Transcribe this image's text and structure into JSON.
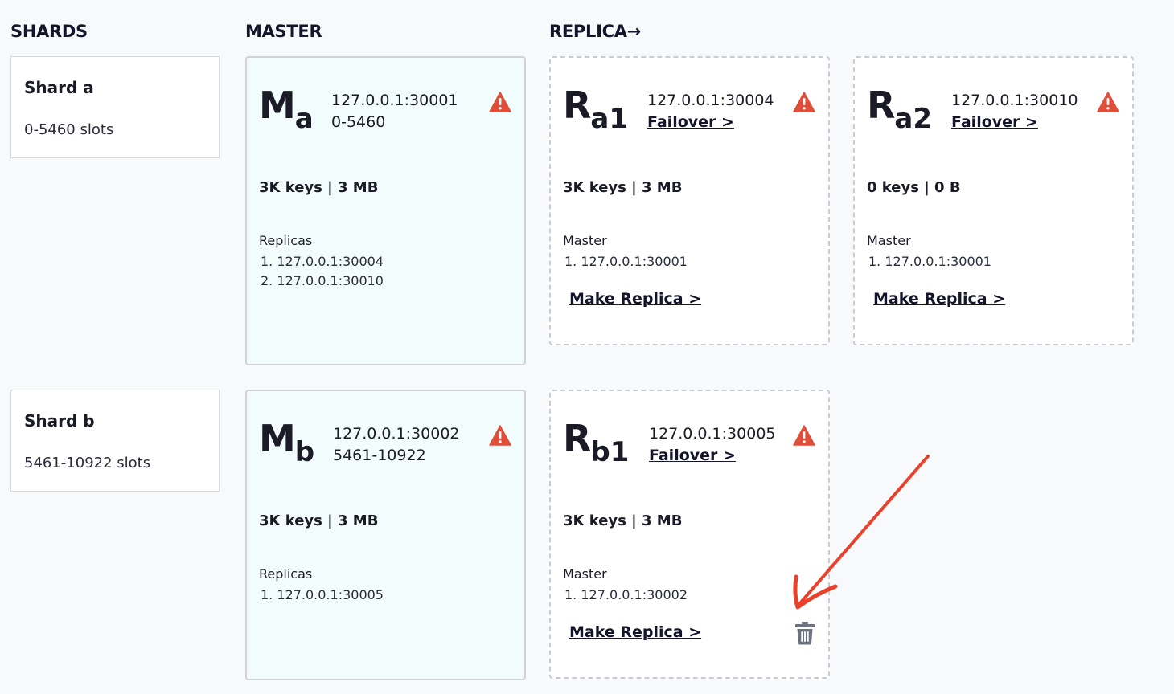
{
  "headers": {
    "shards": "SHARDS",
    "master": "MASTER",
    "replica": "REPLICA→"
  },
  "shards": [
    {
      "name": "Shard a",
      "slots": "0-5460 slots"
    },
    {
      "name": "Shard b",
      "slots": "5461-10922 slots"
    }
  ],
  "masters": [
    {
      "letter": "M",
      "sub": "a",
      "address": "127.0.0.1:30001",
      "range": "0-5460",
      "stats": "3K keys | 3 MB",
      "replicas_label": "Replicas",
      "replicas": [
        "1. 127.0.0.1:30004",
        "2. 127.0.0.1:30010"
      ]
    },
    {
      "letter": "M",
      "sub": "b",
      "address": "127.0.0.1:30002",
      "range": "5461-10922",
      "stats": "3K keys | 3 MB",
      "replicas_label": "Replicas",
      "replicas": [
        "1. 127.0.0.1:30005"
      ]
    }
  ],
  "replicas": [
    {
      "letter": "R",
      "sub": "a1",
      "address": "127.0.0.1:30004",
      "failover": "Failover >",
      "stats": "3K keys | 3 MB",
      "master_label": "Master",
      "master": "1. 127.0.0.1:30001",
      "make_replica": "Make Replica >"
    },
    {
      "letter": "R",
      "sub": "a2",
      "address": "127.0.0.1:30010",
      "failover": "Failover >",
      "stats": "0 keys | 0 B",
      "master_label": "Master",
      "master": "1. 127.0.0.1:30001",
      "make_replica": "Make Replica >"
    },
    {
      "letter": "R",
      "sub": "b1",
      "address": "127.0.0.1:30005",
      "failover": "Failover >",
      "stats": "3K keys | 3 MB",
      "master_label": "Master",
      "master": "1. 127.0.0.1:30002",
      "make_replica": "Make Replica >"
    }
  ],
  "icons": {
    "warning": "warning-triangle-icon",
    "delete": "trash-icon"
  },
  "colors": {
    "warning": "#e04e39",
    "annotation_arrow": "#e8412c",
    "master_bg": "#f3fcfd",
    "trash": "#6b7280"
  }
}
